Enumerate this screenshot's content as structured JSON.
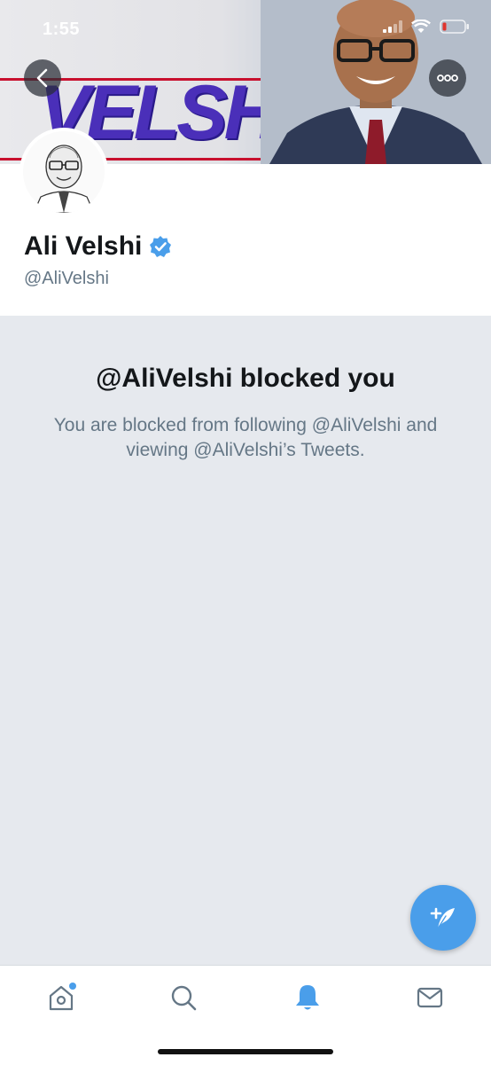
{
  "status_bar": {
    "time": "1:55"
  },
  "banner": {
    "logo_text": "VELSHI"
  },
  "profile": {
    "display_name": "Ali Velshi",
    "handle": "@AliVelshi",
    "verified": true
  },
  "blocked": {
    "title": "@AliVelshi blocked you",
    "message": "You are blocked from following @AliVelshi and viewing @AliVelshi’s Tweets."
  },
  "tabbar": {
    "items": [
      {
        "icon": "home-icon",
        "active": false,
        "has_notification_dot": true
      },
      {
        "icon": "search-icon",
        "active": false
      },
      {
        "icon": "bell-icon",
        "active": true
      },
      {
        "icon": "mail-icon",
        "active": false
      }
    ]
  },
  "colors": {
    "accent": "#4a9eea",
    "muted_text": "#657786",
    "background": "#e6e9ee"
  }
}
